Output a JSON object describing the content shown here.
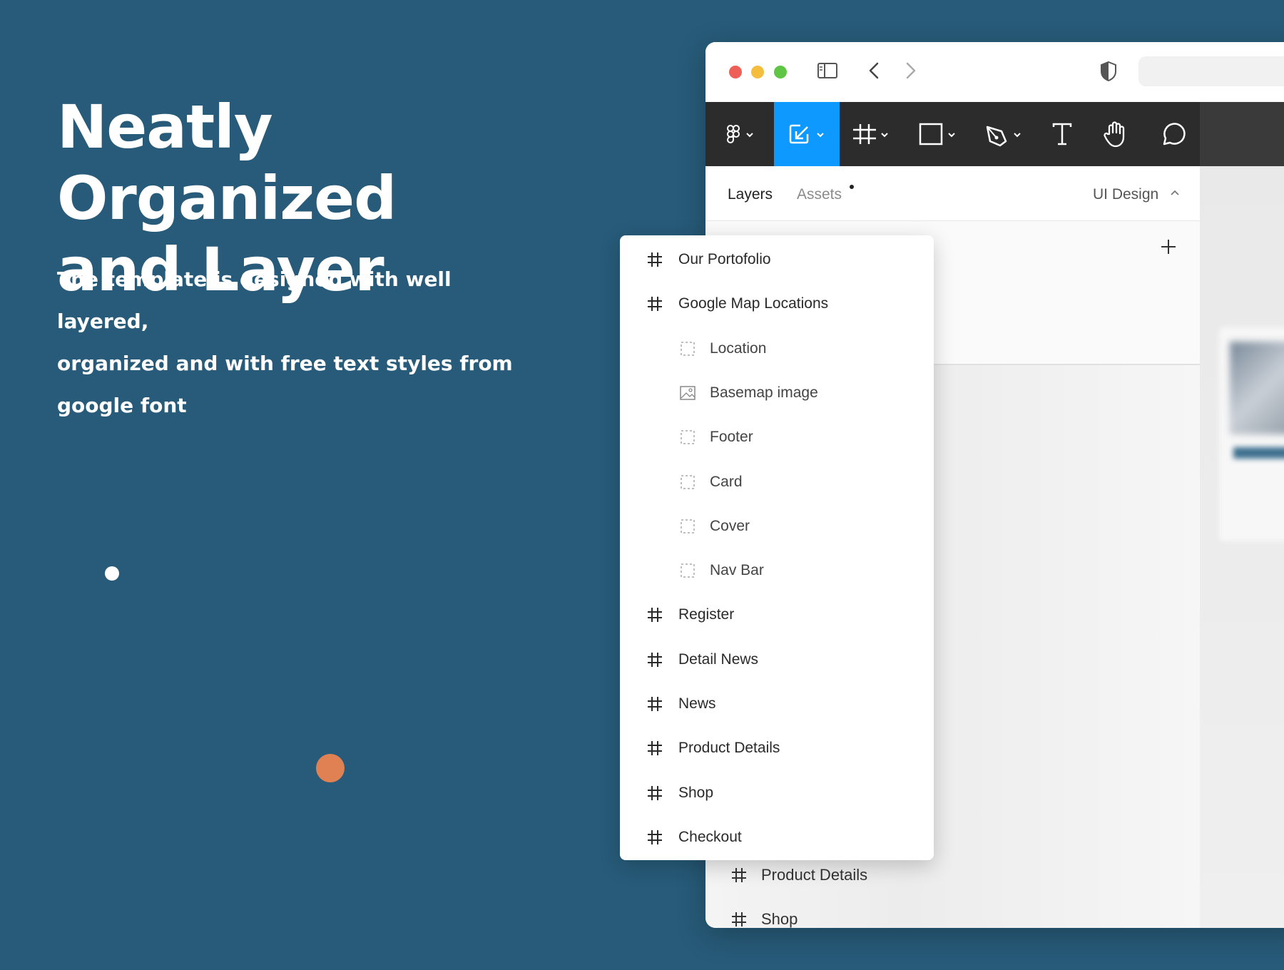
{
  "hero": {
    "title_line1": "Neatly Organized",
    "title_line2": "and Layer",
    "desc_line1": "The template is designed with well layered,",
    "desc_line2": "organized and with free text styles from",
    "desc_line3": "google font"
  },
  "colors": {
    "background": "#275b79",
    "accent_dot": "#df8152",
    "toolbar": "#2c2c2c",
    "active_tool": "#0d99ff"
  },
  "toolbar": {
    "tools": [
      "figma-menu-icon",
      "move-tool-icon",
      "frame-tool-icon",
      "rectangle-tool-icon",
      "pen-tool-icon",
      "text-tool-icon",
      "hand-tool-icon",
      "comment-tool-icon"
    ]
  },
  "panel": {
    "tab_layers": "Layers",
    "tab_assets": "Assets",
    "page_name": "UI Design"
  },
  "layers": [
    {
      "label": "Our Portofolio",
      "type": "frame"
    },
    {
      "label": "Google Map Locations",
      "type": "frame"
    },
    {
      "label": "Location",
      "type": "group"
    },
    {
      "label": "Basemap image",
      "type": "image"
    },
    {
      "label": "Footer",
      "type": "group"
    },
    {
      "label": "Card",
      "type": "group"
    },
    {
      "label": "Cover",
      "type": "group"
    },
    {
      "label": "Nav Bar",
      "type": "group"
    },
    {
      "label": "Register",
      "type": "frame"
    },
    {
      "label": "Detail News",
      "type": "frame"
    },
    {
      "label": "News",
      "type": "frame"
    },
    {
      "label": "Product Details",
      "type": "frame"
    },
    {
      "label": "Shop",
      "type": "frame"
    },
    {
      "label": "Checkout",
      "type": "frame"
    }
  ],
  "background_layers": [
    {
      "label": "Product Details"
    },
    {
      "label": "Shop"
    }
  ]
}
